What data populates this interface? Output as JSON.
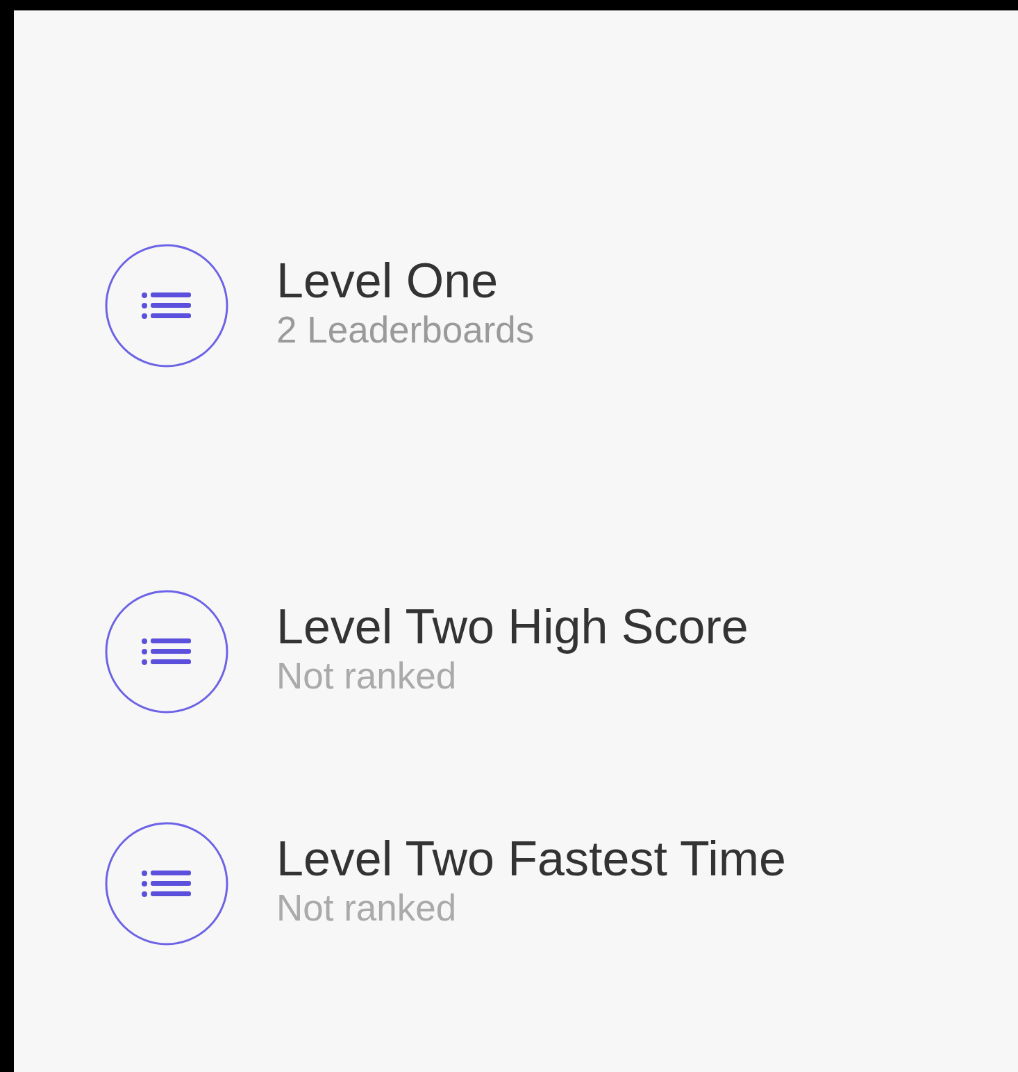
{
  "groups": [
    {
      "title": "Level One",
      "subtitle": "2 Leaderboards"
    }
  ],
  "leaderboards": [
    {
      "title": "Level Two High Score",
      "subtitle": "Not ranked"
    },
    {
      "title": "Level Two Fastest Time",
      "subtitle": "Not ranked"
    }
  ]
}
